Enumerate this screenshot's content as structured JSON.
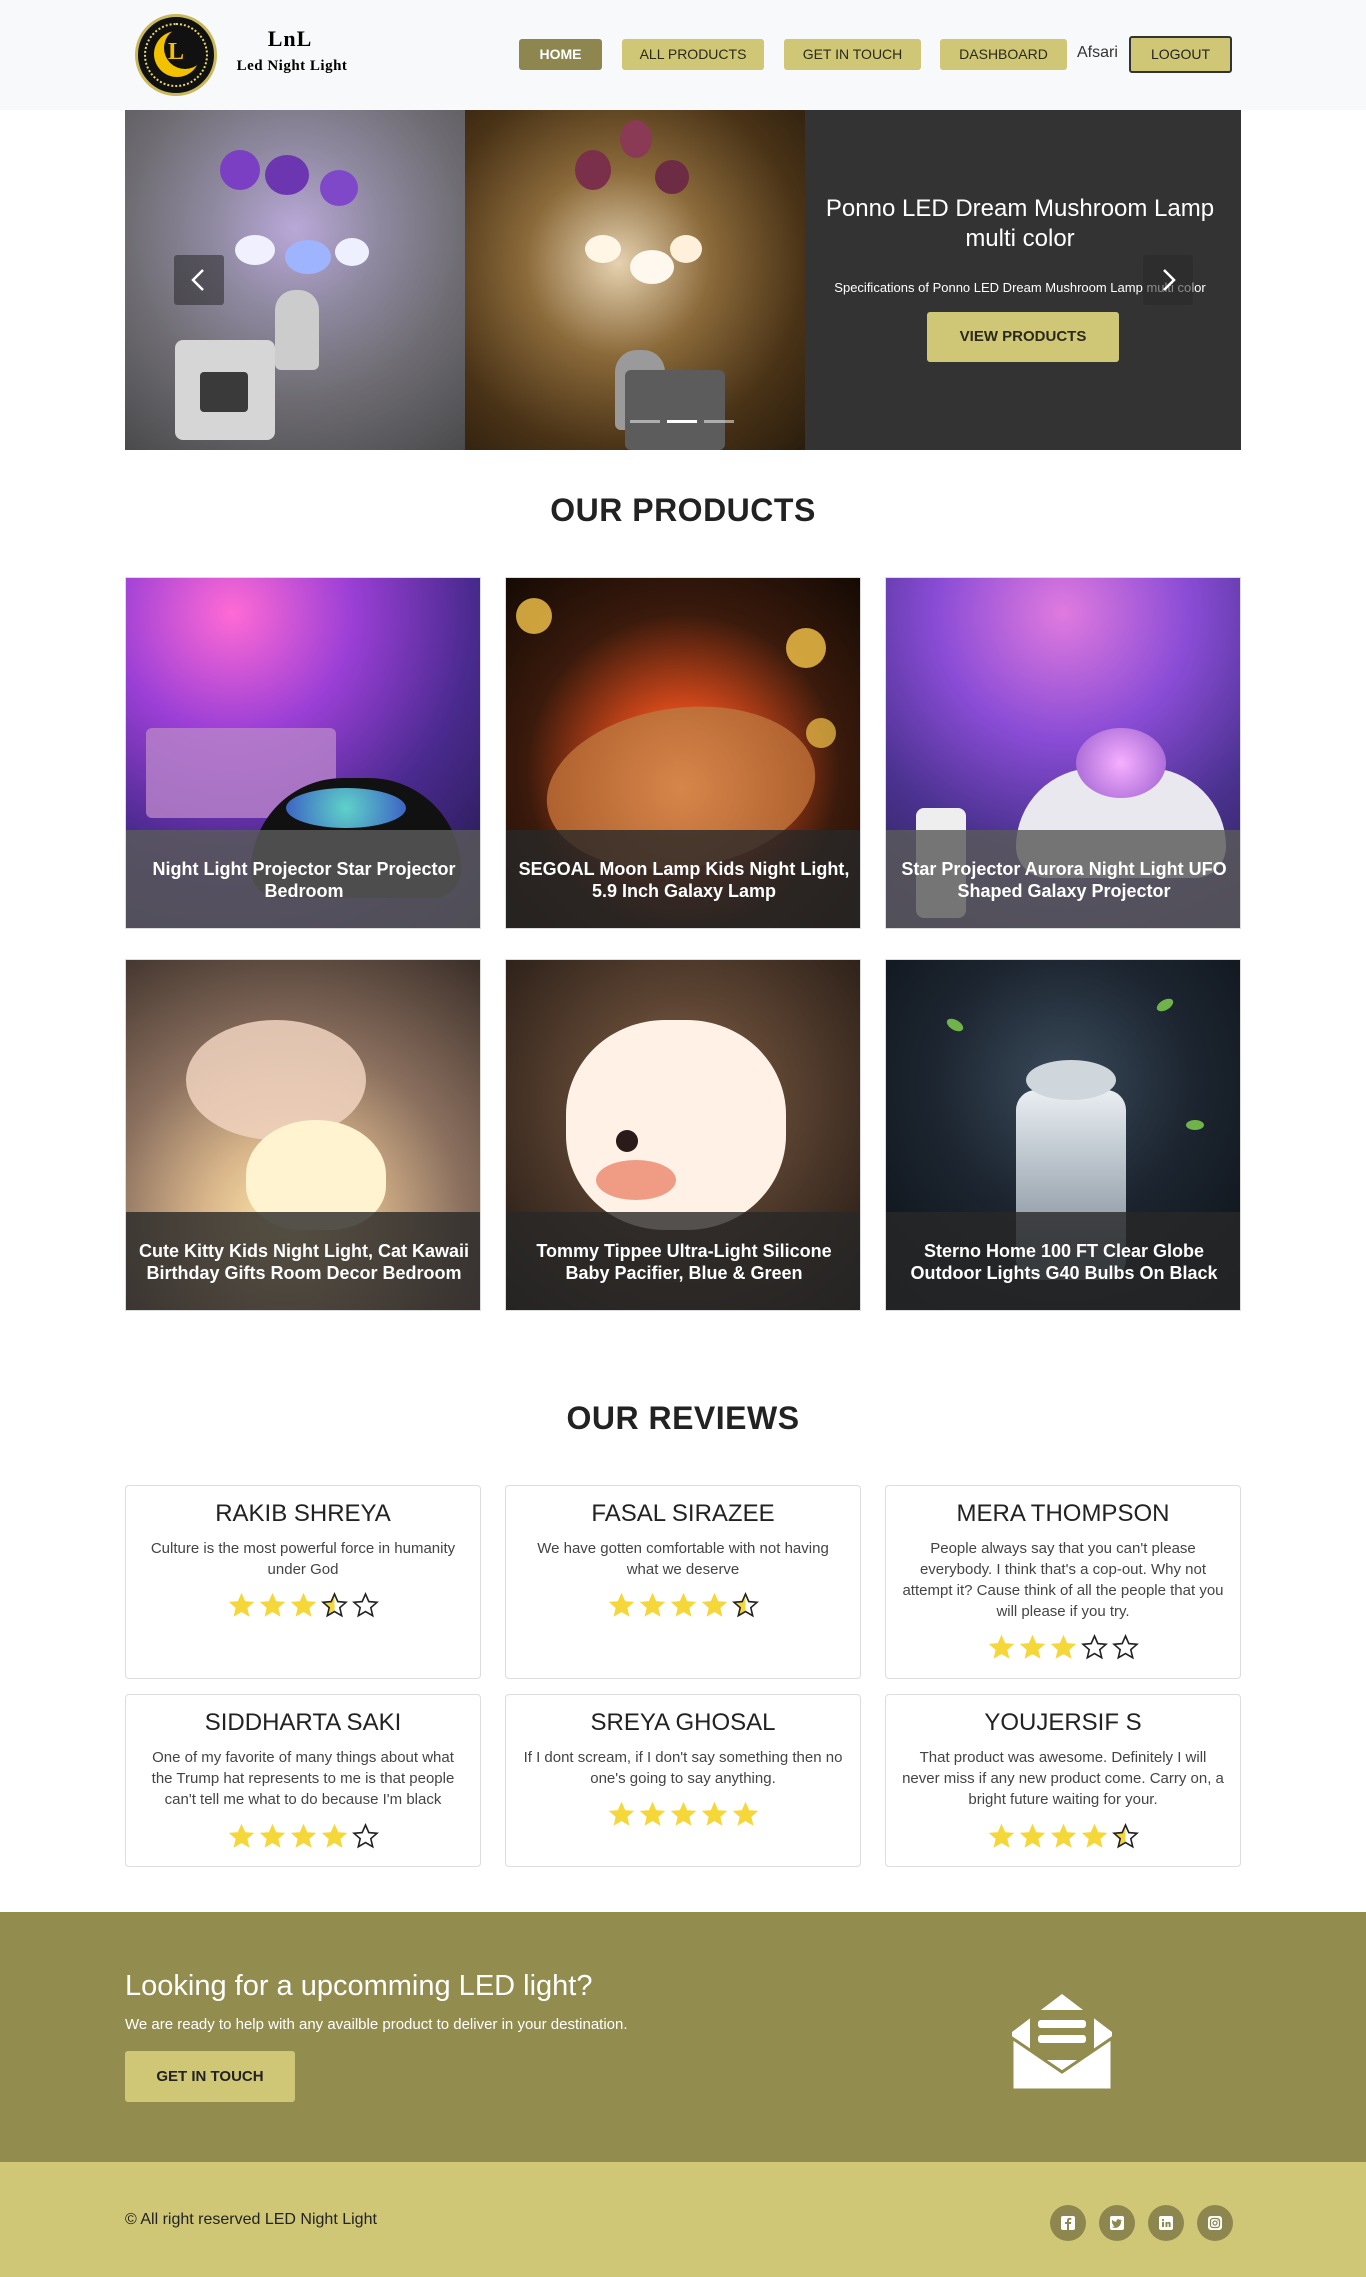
{
  "brand": {
    "logo_letter": "L",
    "short_name": "LnL",
    "full_name": "Led Night Light"
  },
  "nav": {
    "home": "HOME",
    "all_products": "ALL PRODUCTS",
    "get_in_touch": "GET IN TOUCH",
    "dashboard": "DASHBOARD",
    "user": "Afsari",
    "logout": "LOGOUT"
  },
  "carousel": {
    "title": "Ponno LED Dream Mushroom Lamp multi color",
    "text": "Specifications of Ponno LED Dream Mushroom Lamp multi color",
    "button": "VIEW PRODUCTS",
    "active_indicator": 2,
    "indicator_count": 3
  },
  "products": {
    "title": "OUR PRODUCTS",
    "items": [
      {
        "name": "Night Light Projector Star Projector Bedroom"
      },
      {
        "name": "SEGOAL Moon Lamp Kids Night Light, 5.9 Inch Galaxy Lamp"
      },
      {
        "name": "Star Projector Aurora Night Light UFO Shaped Galaxy Projector"
      },
      {
        "name": "Cute Kitty Kids Night Light, Cat Kawaii Birthday Gifts Room Decor Bedroom"
      },
      {
        "name": "Tommy Tippee Ultra-Light Silicone Baby Pacifier, Blue & Green"
      },
      {
        "name": "Sterno Home 100 FT Clear Globe Outdoor Lights G40 Bulbs On Black"
      }
    ]
  },
  "reviews": {
    "title": "OUR REVIEWS",
    "items": [
      {
        "name": "RAKIB SHREYA",
        "text": "Culture is the most powerful force in humanity under God",
        "rating": 3.5
      },
      {
        "name": "FASAL SIRAZEE",
        "text": "We have gotten comfortable with not having what we deserve",
        "rating": 4.5
      },
      {
        "name": "MERA THOMPSON",
        "text": "People always say that you can't please everybody. I think that's a cop-out. Why not attempt it? Cause think of all the people that you will please if you try.",
        "rating": 3
      },
      {
        "name": "SIDDHARTA SAKI",
        "text": "One of my favorite of many things about what the Trump hat represents to me is that people can't tell me what to do because I'm black",
        "rating": 4
      },
      {
        "name": "SREYA GHOSAL",
        "text": "If I dont scream, if I don't say something then no one's going to say anything.",
        "rating": 5
      },
      {
        "name": "YOUJERSIF S",
        "text": "That product was awesome. Definitely I will never miss if any new product come. Carry on, a bright future waiting for your.",
        "rating": 4.5
      }
    ]
  },
  "cta": {
    "title": "Looking for a upcomming LED light?",
    "text": "We are ready to help with any availble product to deliver in your destination.",
    "button": "GET IN TOUCH",
    "icon": "envelope-open-text-icon"
  },
  "footer": {
    "copyright": "© All right reserved LED Night Light",
    "social": [
      "facebook-icon",
      "twitter-icon",
      "linkedin-icon",
      "instagram-icon"
    ]
  },
  "colors": {
    "accent": "#d0c776",
    "accent_dark": "#8d874f",
    "cta_bg": "#938c4f",
    "star": "#f5d73a"
  }
}
